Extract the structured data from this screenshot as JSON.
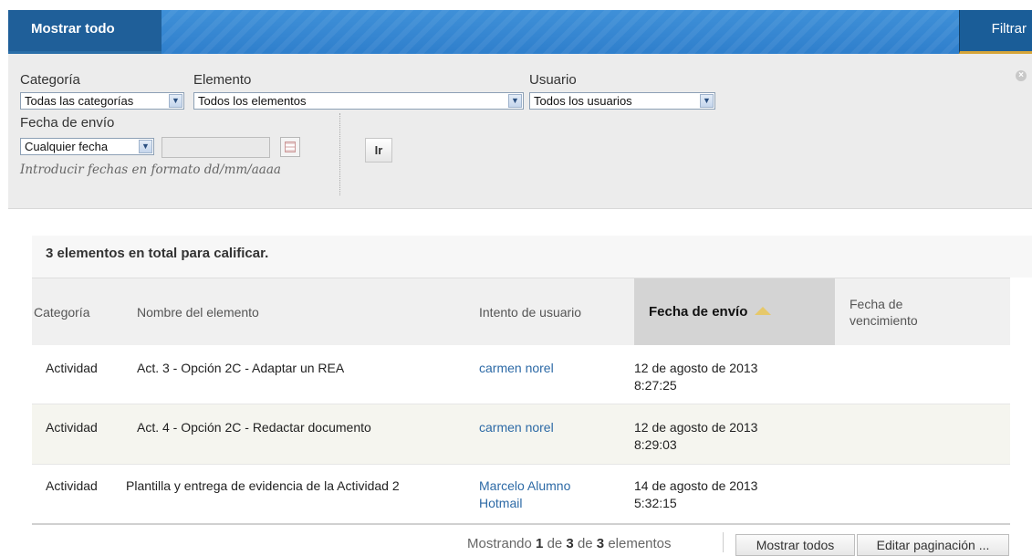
{
  "toolbar": {
    "show_all": "Mostrar todo",
    "filter": "Filtrar"
  },
  "filters": {
    "category_label": "Categoría",
    "category_value": "Todas las categorías",
    "element_label": "Elemento",
    "element_value": "Todos los elementos",
    "user_label": "Usuario",
    "user_value": "Todos los usuarios",
    "date_label": "Fecha de envío",
    "date_value": "Cualquier fecha",
    "date_input_value": "",
    "date_hint": "Introducir fechas en formato dd/mm/aaaa",
    "go": "Ir"
  },
  "summary": {
    "count_text": "3 elementos en total para calificar."
  },
  "table": {
    "headers": {
      "category": "Categoría",
      "name": "Nombre del elemento",
      "attempt": "Intento de usuario",
      "submitted": "Fecha de envío",
      "due_line1": "Fecha de",
      "due_line2": "vencimiento"
    },
    "rows": [
      {
        "category": "Actividad",
        "name": "Act. 3 - Opción 2C - Adaptar un REA",
        "user_line1": "carmen norel",
        "user_line2": "",
        "date_line1": "12 de agosto de 2013",
        "date_line2": "8:27:25",
        "due": ""
      },
      {
        "category": "Actividad",
        "name": "Act. 4 - Opción 2C - Redactar documento",
        "user_line1": "carmen norel",
        "user_line2": "",
        "date_line1": "12 de agosto de 2013",
        "date_line2": "8:29:03",
        "due": ""
      },
      {
        "category": "Actividad",
        "name": "Plantilla y entrega de evidencia de la Actividad 2",
        "user_line1": "Marcelo Alumno",
        "user_line2": "Hotmail",
        "date_line1": "14 de agosto de 2013",
        "date_line2": "5:32:15",
        "due": ""
      }
    ]
  },
  "pagination": {
    "prefix": "Mostrando",
    "from": "1",
    "mid1": "de",
    "to": "3",
    "mid2": "de",
    "total": "3",
    "suffix": "elementos",
    "show_all": "Mostrar todos",
    "edit_paging": "Editar paginación ..."
  },
  "colors": {
    "brand_blue": "#2f7fcc",
    "tab_dark": "#1f5f99",
    "link": "#2d6aa6"
  }
}
